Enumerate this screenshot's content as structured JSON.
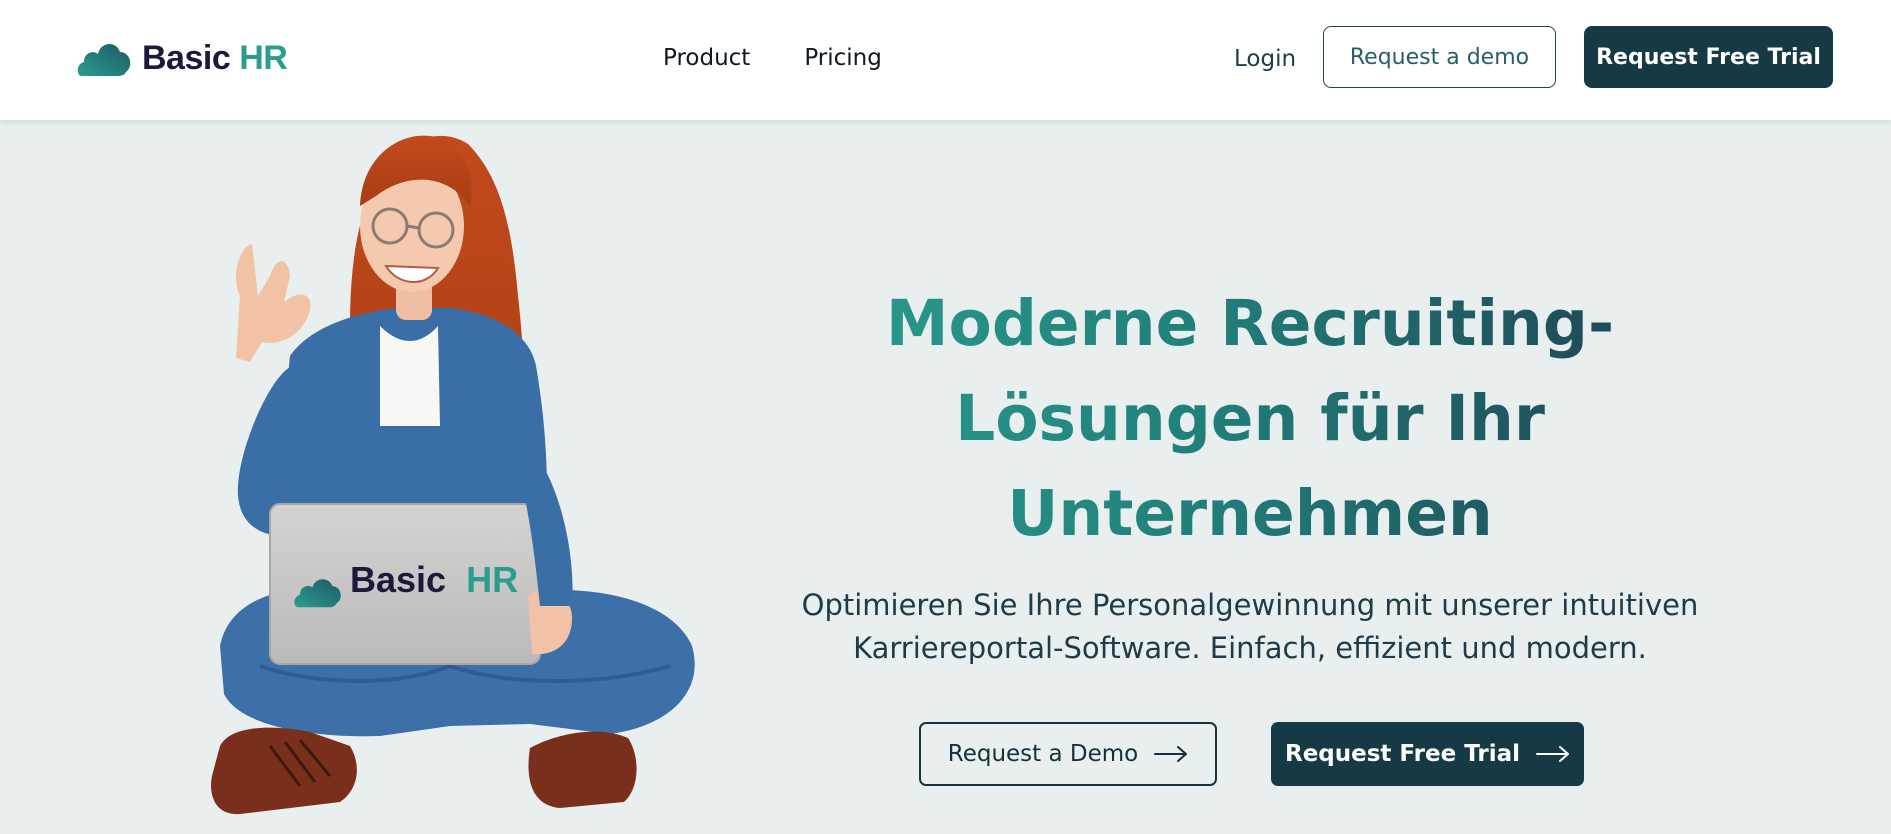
{
  "header": {
    "logo": {
      "word1": "Basic",
      "word2": "HR",
      "icon": "cloud-icon"
    },
    "nav": [
      {
        "label": "Product"
      },
      {
        "label": "Pricing"
      }
    ],
    "login_label": "Login",
    "request_demo_label": "Request a demo",
    "free_trial_label": "Request Free Trial"
  },
  "hero": {
    "image": {
      "description_icon": "woman-with-laptop-illustration",
      "laptop_logo": {
        "word1": "Basic",
        "word2": "HR"
      }
    },
    "title_lines": [
      "Moderne Recruiting-",
      "Lösungen für Ihr",
      "Unternehmen"
    ],
    "subtitle_lines": [
      "Optimieren Sie Ihre Personalgewinnung mit unserer intuitiven",
      "Karriereportal-Software. Einfach, effizient und modern."
    ],
    "demo_button_label": "Request a Demo",
    "trial_button_label": "Request Free Trial",
    "arrow_icon": "arrow-right-icon"
  },
  "colors": {
    "brand_dark": "#163a45",
    "brand_teal": "#2a9d8f",
    "hero_bg": "#e9efef",
    "logo_navy": "#1b1a3b"
  }
}
